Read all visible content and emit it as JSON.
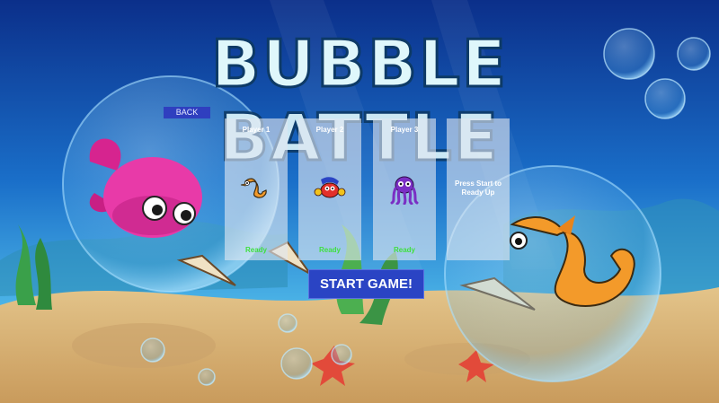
{
  "game": {
    "title_line1": "BUBBLE",
    "title_line2": "BATTLE"
  },
  "menu": {
    "back_label": "BACK",
    "start_label": "START GAME!"
  },
  "players": [
    {
      "name": "Player 1",
      "status": "Ready",
      "character": "seahorse-icon"
    },
    {
      "name": "Player 2",
      "status": "Ready",
      "character": "crab-icon"
    },
    {
      "name": "Player 3",
      "status": "Ready",
      "character": "octopus-icon"
    },
    {
      "name": "",
      "status": "",
      "prompt": "Press Start to Ready Up"
    }
  ],
  "colors": {
    "ready": "#3fe03f",
    "button": "#2a44c4",
    "back_button": "#2f3fbf",
    "ocean_top": "#0b2f8a",
    "sand": "#d9b77a"
  }
}
